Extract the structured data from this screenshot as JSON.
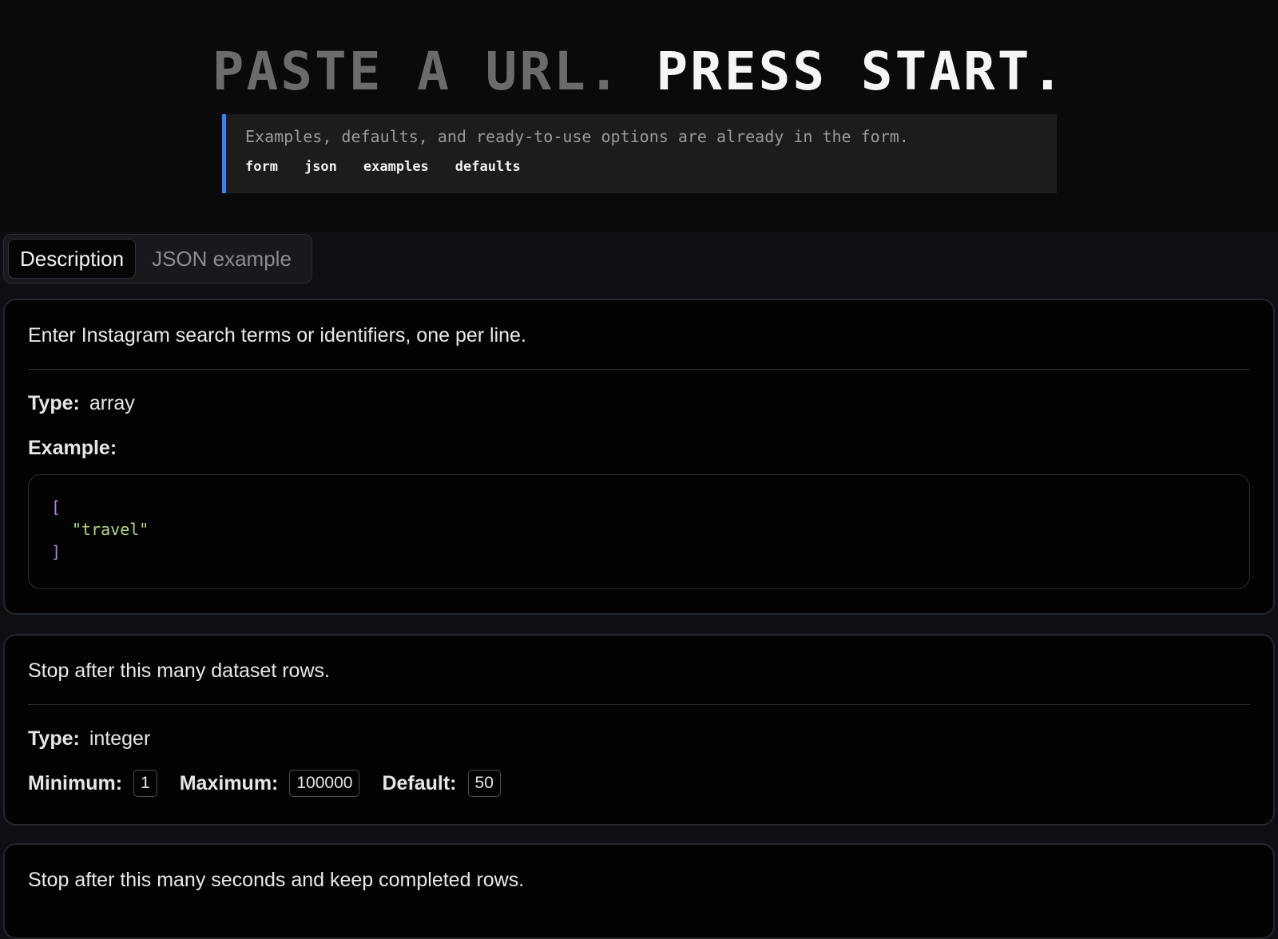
{
  "hero": {
    "title_part1": "PASTE A URL.",
    "title_part2": "PRESS START.",
    "subtitle": "Examples, defaults, and ready-to-use options are already in the form.",
    "tags": [
      "form",
      "json",
      "examples",
      "defaults"
    ],
    "accent_color": "#3b82f6"
  },
  "tabs": [
    {
      "label": "Description",
      "active": true
    },
    {
      "label": "JSON example",
      "active": false
    }
  ],
  "fields": [
    {
      "description": "Enter Instagram search terms or identifiers, one per line.",
      "type_label": "Type:",
      "type_value": "array",
      "example_label": "Example:",
      "example_open": "[",
      "example_item": "\"travel\"",
      "example_close": "]"
    },
    {
      "description": "Stop after this many dataset rows.",
      "type_label": "Type:",
      "type_value": "integer",
      "min_label": "Minimum:",
      "min_value": "1",
      "max_label": "Maximum:",
      "max_value": "100000",
      "default_label": "Default:",
      "default_value": "50"
    },
    {
      "description": "Stop after this many seconds and keep completed rows."
    }
  ]
}
